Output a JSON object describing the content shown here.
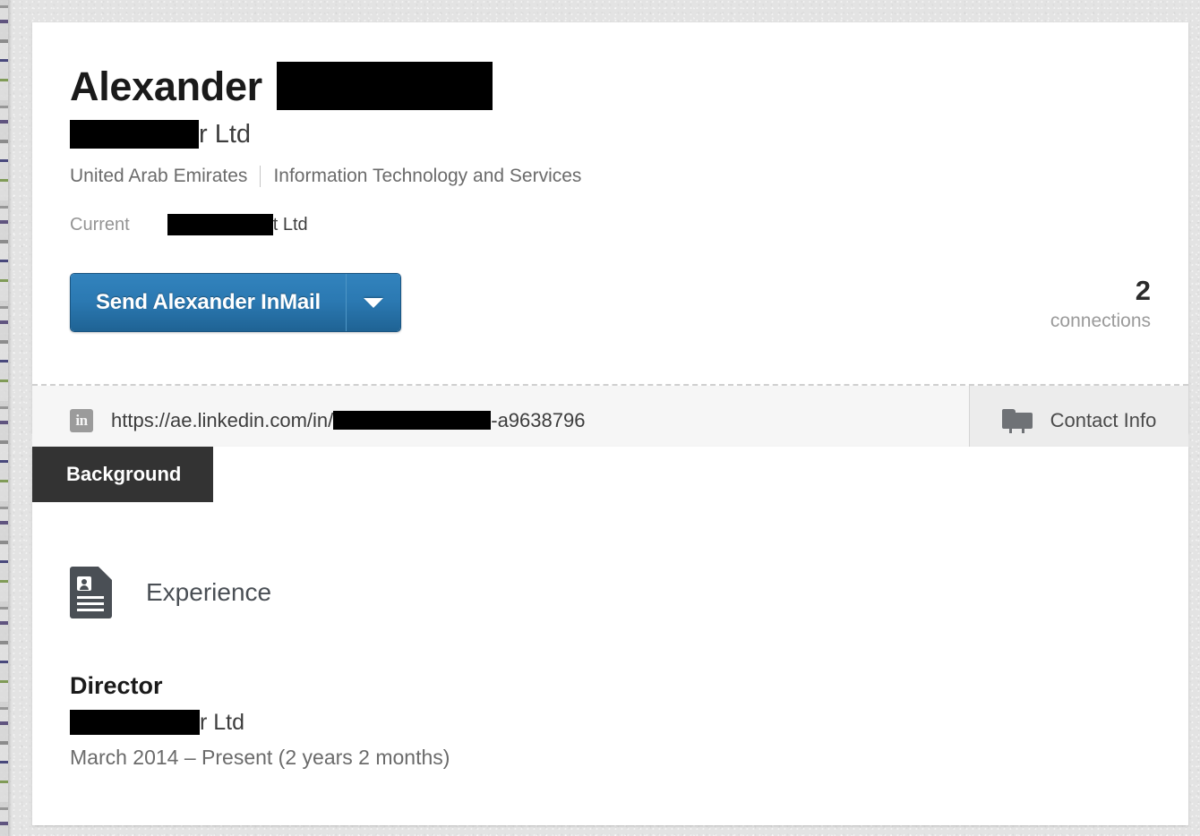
{
  "profile": {
    "first_name": "Alexander",
    "name_redacted": true,
    "headline_suffix": "r Ltd",
    "location": "United Arab Emirates",
    "industry": "Information Technology and Services",
    "current_label": "Current",
    "current_company_suffix": "t Ltd",
    "connections_count": "2",
    "connections_label": "connections"
  },
  "actions": {
    "inmail_label": "Send Alexander InMail",
    "caret_icon": "chevron-down-icon"
  },
  "public_url": {
    "icon": "linkedin-icon",
    "prefix": "https://ae.linkedin.com/in/",
    "suffix": "-a9638796"
  },
  "contact_info": {
    "icon": "contact-card-icon",
    "label": "Contact Info"
  },
  "background": {
    "tab_label": "Background",
    "experience": {
      "icon": "document-profile-icon",
      "section_title": "Experience",
      "positions": [
        {
          "title": "Director",
          "company_suffix": "r Ltd",
          "dates": "March 2014 – Present (2 years 2 months)"
        }
      ]
    }
  },
  "colors": {
    "page_bg": "#e3e3e3",
    "card_bg": "#ffffff",
    "primary_button": "#2b79b2",
    "tab_bg": "#333333",
    "url_strip_bg": "#f6f6f6",
    "contact_button_bg": "#ececec",
    "redaction": "#000000"
  }
}
